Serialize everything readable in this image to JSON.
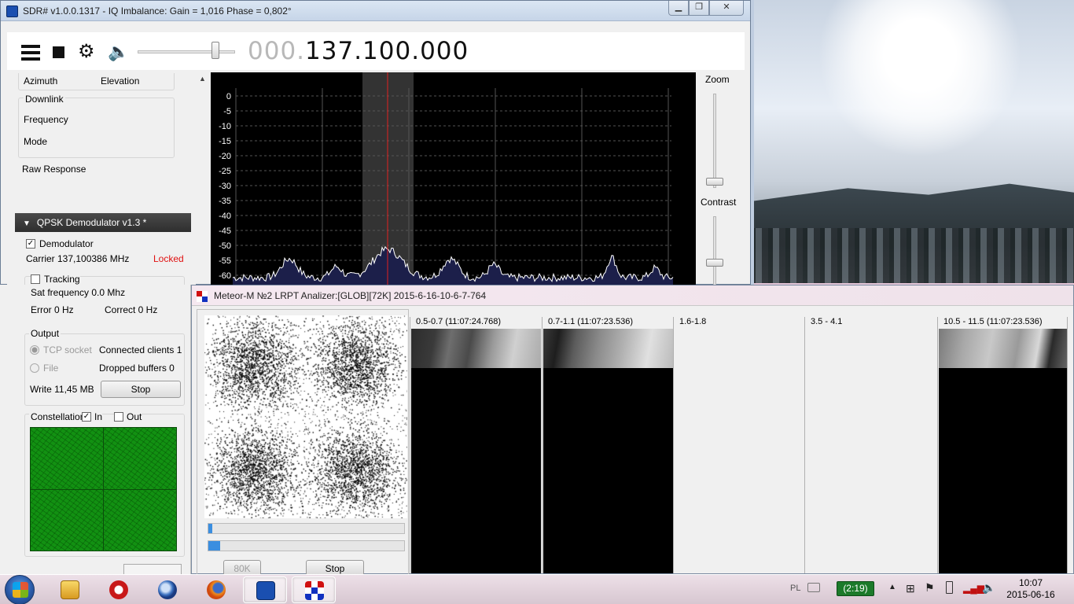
{
  "sdr": {
    "title": "SDR# v1.0.0.1317 - IQ Imbalance: Gain = 1,016 Phase = 0,802°",
    "frequency_dim": "000.",
    "frequency_main": "137.100.000",
    "volume_level": 0.8,
    "left": {
      "azimuth": "Azimuth",
      "elevation": "Elevation",
      "downlink": "Downlink",
      "frequency": "Frequency",
      "mode": "Mode",
      "raw_response": "Raw Response"
    },
    "qpsk": {
      "header": "QPSK Demodulator v1.3 *",
      "demodulator": "Demodulator",
      "carrier": "Carrier 137,100386 MHz",
      "locked": "Locked",
      "tracking": "Tracking",
      "sat_frequency": "Sat frequency 0.0 Mhz",
      "error": "Error 0 Hz",
      "correct": "Correct 0 Hz",
      "output": "Output",
      "tcp_socket": "TCP socket",
      "connected_clients": "Connected clients 1",
      "file": "File",
      "dropped_buffers": "Dropped buffers 0",
      "write": "Write 11,45 MB",
      "stop": "Stop",
      "constellation": "Constellation",
      "in": "In",
      "out": "Out"
    },
    "spectrum": {
      "y_ticks": [
        "0",
        "-5",
        "-10",
        "-15",
        "-20",
        "-25",
        "-30",
        "-35",
        "-40",
        "-45",
        "-50",
        "-55",
        "-60"
      ]
    },
    "zoom_label": "Zoom",
    "contrast_label": "Contrast"
  },
  "meteor": {
    "title": "Meteor-M №2 LRPT Analizer:[GLOB][72K] 2015-6-16-10-6-7-764",
    "progress1": 0.02,
    "progress2": 0.06,
    "btn_80k": "80K",
    "btn_stop": "Stop",
    "channels": [
      {
        "label": "0.5-0.7 (11:07:24.768)",
        "has_image": true
      },
      {
        "label": "0.7-1.1 (11:07:23.536)",
        "has_image": true
      },
      {
        "label": "1.6-1.8",
        "has_image": false
      },
      {
        "label": "3.5 - 4.1",
        "has_image": false
      },
      {
        "label": "10.5 - 11.5 (11:07:23.536)",
        "has_image": true
      }
    ]
  },
  "taskbar": {
    "language": "PL",
    "battery": "(2:19)",
    "time": "10:07",
    "date": "2015-06-16",
    "apps": [
      "explorer-icon",
      "opera-icon",
      "thunderbird-icon",
      "firefox-icon",
      "sdrsharp-icon",
      "meteor-analyzer-icon"
    ]
  }
}
